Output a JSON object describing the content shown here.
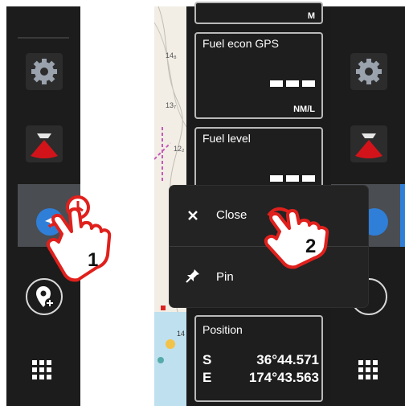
{
  "left_panel": {
    "icons": [
      "gear-icon",
      "sonar-icon",
      "navigation-arrow-icon",
      "add-waypoint-icon",
      "apps-grid-icon"
    ],
    "callout_number": "1"
  },
  "right_panel": {
    "top_box_unit": "M",
    "fuel_econ": {
      "title": "Fuel econ GPS",
      "value": "———",
      "unit": "NM/L"
    },
    "fuel_level": {
      "title": "Fuel level",
      "value": "———"
    },
    "position": {
      "title": "Position",
      "lat_dir": "S",
      "lat": "36°44.571",
      "lon_dir": "E",
      "lon": "174°43.563"
    },
    "chart_depths": [
      "14₈",
      "13₇",
      "12₂",
      "14"
    ],
    "context_menu": {
      "close_label": "Close",
      "pin_label": "Pin"
    },
    "callout_number": "2"
  },
  "colors": {
    "accent_blue": "#2f7fd8",
    "touch_red": "#e0201c",
    "sidebar_bg": "#1c1c1c"
  }
}
